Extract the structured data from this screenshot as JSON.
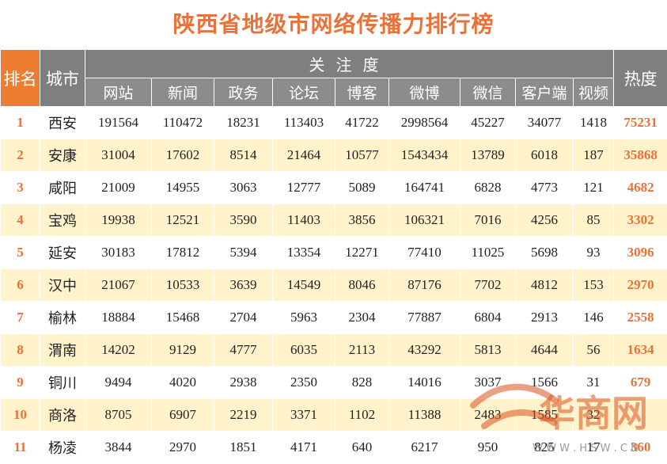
{
  "title": "陕西省地级市网络传播力排行榜",
  "header": {
    "rank": "排名",
    "city": "城市",
    "group": "关注度",
    "heat": "热度",
    "columns": [
      "网站",
      "新闻",
      "政务",
      "论坛",
      "博客",
      "微博",
      "微信",
      "客户端",
      "视频"
    ]
  },
  "rows": [
    {
      "rank": "1",
      "city": "西安",
      "values": [
        "191564",
        "110472",
        "18231",
        "113403",
        "41722",
        "2998564",
        "45227",
        "34077",
        "1418"
      ],
      "heat": "75231"
    },
    {
      "rank": "2",
      "city": "安康",
      "values": [
        "31004",
        "17602",
        "8514",
        "21464",
        "10577",
        "1543434",
        "13789",
        "6018",
        "187"
      ],
      "heat": "35868"
    },
    {
      "rank": "3",
      "city": "咸阳",
      "values": [
        "21009",
        "14955",
        "3063",
        "12777",
        "5089",
        "164741",
        "6828",
        "4773",
        "121"
      ],
      "heat": "4682"
    },
    {
      "rank": "4",
      "city": "宝鸡",
      "values": [
        "19938",
        "12521",
        "3590",
        "11403",
        "3856",
        "106321",
        "7016",
        "4256",
        "85"
      ],
      "heat": "3302"
    },
    {
      "rank": "5",
      "city": "延安",
      "values": [
        "30183",
        "17812",
        "5394",
        "13354",
        "12271",
        "77410",
        "11025",
        "5698",
        "93"
      ],
      "heat": "3096"
    },
    {
      "rank": "6",
      "city": "汉中",
      "values": [
        "21067",
        "10533",
        "3639",
        "14549",
        "8046",
        "87176",
        "7702",
        "4812",
        "153"
      ],
      "heat": "2970"
    },
    {
      "rank": "7",
      "city": "榆林",
      "values": [
        "18884",
        "15468",
        "2704",
        "5963",
        "2304",
        "77887",
        "6804",
        "2913",
        "146"
      ],
      "heat": "2558"
    },
    {
      "rank": "8",
      "city": "渭南",
      "values": [
        "14202",
        "9129",
        "4777",
        "6035",
        "2113",
        "43292",
        "5813",
        "4644",
        "56"
      ],
      "heat": "1634"
    },
    {
      "rank": "9",
      "city": "铜川",
      "values": [
        "9494",
        "4020",
        "2938",
        "2350",
        "828",
        "14016",
        "3037",
        "1566",
        "31"
      ],
      "heat": "679"
    },
    {
      "rank": "10",
      "city": "商洛",
      "values": [
        "8705",
        "6907",
        "2219",
        "3371",
        "1102",
        "11388",
        "2483",
        "1585",
        "32",
        ""
      ],
      "heat": ""
    },
    {
      "rank": "11",
      "city": "杨凌",
      "values": [
        "3844",
        "2970",
        "1851",
        "4171",
        "640",
        "6217",
        "950",
        "825",
        "17"
      ],
      "heat": "360"
    }
  ],
  "watermark": {
    "logo_text": "华商网",
    "url_text": "W W W . H S W . C N"
  },
  "colors": {
    "accent": "#ed7d31",
    "title": "#e8733a",
    "header_gray": "#7f7f7f",
    "stripe": "#fff3cc",
    "watermark_red": "#d9531e"
  }
}
